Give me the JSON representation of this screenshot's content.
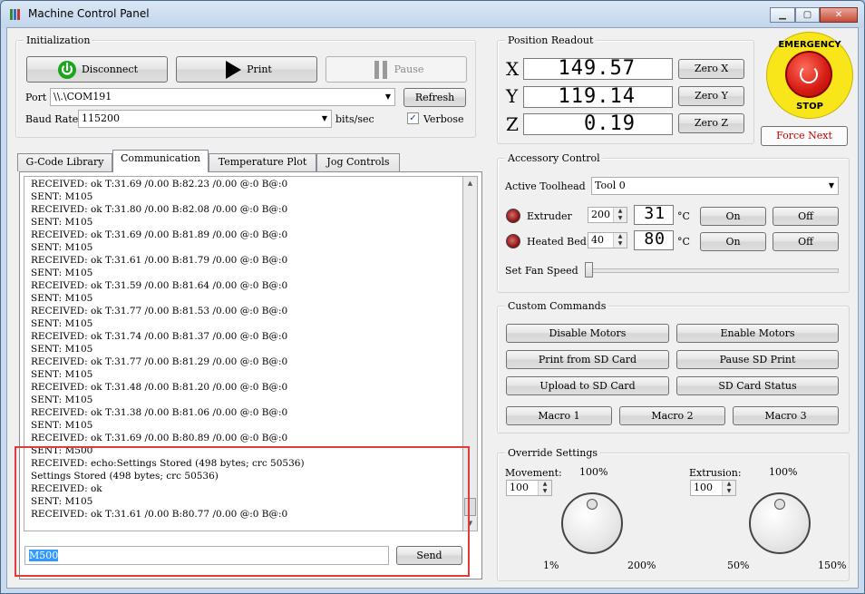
{
  "window": {
    "title": "Machine Control Panel",
    "min": "▁",
    "max": "▢",
    "close": "✕"
  },
  "init": {
    "label": "Initialization",
    "disconnect": "Disconnect",
    "print": "Print",
    "pause": "Pause",
    "port_label": "Port",
    "port_value": "\\\\.\\COM191",
    "refresh": "Refresh",
    "baud_label": "Baud Rate",
    "baud_value": "115200",
    "baud_unit": "bits/sec",
    "verbose_label": "Verbose",
    "verbose_checked": "✓"
  },
  "position": {
    "label": "Position Readout",
    "x_axis": "X",
    "x_value": "149.57",
    "zero_x": "Zero X",
    "y_axis": "Y",
    "y_value": "119.14",
    "zero_y": "Zero Y",
    "z_axis": "Z",
    "z_value": "0.19",
    "zero_z": "Zero Z"
  },
  "estop": {
    "top_text": "EMERGENCY",
    "bottom_text": "STOP",
    "force_next": "Force Next"
  },
  "tabs": [
    "G-Code Library",
    "Communication",
    "Temperature Plot",
    "Jog Controls"
  ],
  "log": [
    "RECEIVED: ok T:31.69 /0.00 B:82.23 /0.00 @:0 B@:0",
    "SENT: M105",
    "RECEIVED: ok T:31.80 /0.00 B:82.08 /0.00 @:0 B@:0",
    "SENT: M105",
    "RECEIVED: ok T:31.69 /0.00 B:81.89 /0.00 @:0 B@:0",
    "SENT: M105",
    "RECEIVED: ok T:31.61 /0.00 B:81.79 /0.00 @:0 B@:0",
    "SENT: M105",
    "RECEIVED: ok T:31.59 /0.00 B:81.64 /0.00 @:0 B@:0",
    "SENT: M105",
    "RECEIVED: ok T:31.77 /0.00 B:81.53 /0.00 @:0 B@:0",
    "SENT: M105",
    "RECEIVED: ok T:31.74 /0.00 B:81.37 /0.00 @:0 B@:0",
    "SENT: M105",
    "RECEIVED: ok T:31.77 /0.00 B:81.29 /0.00 @:0 B@:0",
    "SENT: M105",
    "RECEIVED: ok T:31.48 /0.00 B:81.20 /0.00 @:0 B@:0",
    "SENT: M105",
    "RECEIVED: ok T:31.38 /0.00 B:81.06 /0.00 @:0 B@:0",
    "SENT: M105",
    "RECEIVED: ok T:31.69 /0.00 B:80.89 /0.00 @:0 B@:0",
    "SENT: M500",
    "RECEIVED: echo:Settings Stored (498 bytes; crc 50536)",
    "Settings Stored (498 bytes; crc 50536)",
    "RECEIVED: ok",
    "SENT: M105",
    "RECEIVED: ok T:31.61 /0.00 B:80.77 /0.00 @:0 B@:0"
  ],
  "command": {
    "value": "M500",
    "send": "Send"
  },
  "accessory": {
    "label": "Accessory Control",
    "toolhead_label": "Active Toolhead",
    "toolhead_value": "Tool 0",
    "extruder_label": "Extruder",
    "extruder_set": "200",
    "extruder_temp": "31",
    "bed_label": "Heated Bed",
    "bed_set": "40",
    "bed_temp": "80",
    "unit": "°C",
    "on": "On",
    "off": "Off",
    "fan_label": "Set Fan Speed",
    "fan_value": 0
  },
  "custom": {
    "label": "Custom Commands",
    "disable_motors": "Disable Motors",
    "enable_motors": "Enable Motors",
    "print_sd": "Print from SD Card",
    "pause_sd": "Pause SD Print",
    "upload_sd": "Upload to SD Card",
    "sd_status": "SD Card Status",
    "macro1": "Macro 1",
    "macro2": "Macro 2",
    "macro3": "Macro 3"
  },
  "override": {
    "label": "Override Settings",
    "movement_label": "Movement:",
    "movement_pct": "100%",
    "movement_value": "100",
    "movement_min": "1%",
    "movement_max": "200%",
    "extrusion_label": "Extrusion:",
    "extrusion_pct": "100%",
    "extrusion_value": "100",
    "extrusion_min": "50%",
    "extrusion_max": "150%"
  },
  "colors": {
    "accent_highlight": "#e03c3c",
    "led_red": "#b31010",
    "estop_yellow": "#f8e61a",
    "force_next_text": "#c00000",
    "connect_green": "#1aa51a"
  },
  "icons": {
    "disconnect": "power-icon",
    "print": "play-icon",
    "pause": "pause-icon",
    "app": "app-icon"
  }
}
